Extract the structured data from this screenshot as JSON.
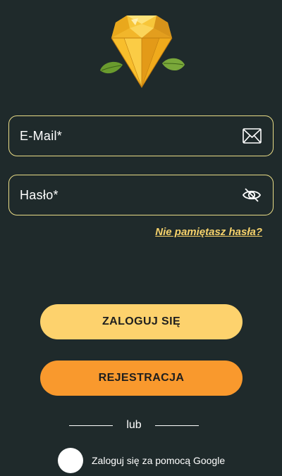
{
  "logo": {
    "icon": "diamond-logo-icon",
    "gem_color": "#f3b220",
    "leaf_color": "#6a9b2e"
  },
  "form": {
    "email_placeholder": "E-Mail*",
    "email_value": "",
    "email_icon": "envelope-icon",
    "password_placeholder": "Hasło*",
    "password_value": "",
    "password_icon": "eye-hidden-icon",
    "forgot_label": "Nie pamiętasz hasła?"
  },
  "buttons": {
    "login_label": "ZALOGUJ SIĘ",
    "register_label": "REJESTRACJA"
  },
  "divider": {
    "label": "lub"
  },
  "google": {
    "label": "Zaloguj się za pomocą Google"
  },
  "colors": {
    "background": "#1f2a2b",
    "field_border": "#e9dc86",
    "login_button": "#fdd26d",
    "register_button": "#f9992d",
    "link": "#f6d26b"
  }
}
